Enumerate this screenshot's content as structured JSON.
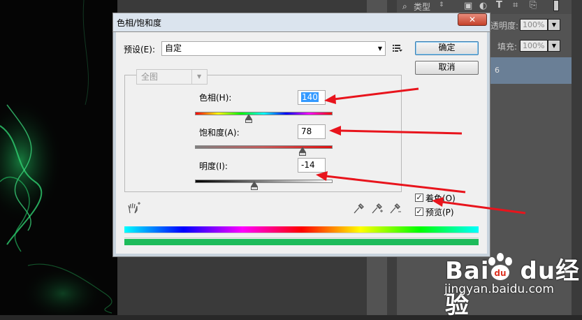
{
  "dialog": {
    "title": "色相/饱和度",
    "close_glyph": "✕",
    "preset_label": "预设(E):",
    "preset_value": "自定",
    "ok_label": "确定",
    "cancel_label": "取消",
    "channel_value": "全图",
    "hue_label": "色相(H):",
    "hue_value": "140",
    "hue_level": 140,
    "saturation_label": "饱和度(A):",
    "saturation_value": "78",
    "saturation_level": 78,
    "lightness_label": "明度(I):",
    "lightness_value": "-14",
    "lightness_level": -14,
    "colorize_label": "着色(O)",
    "colorize_checked": true,
    "preview_label": "预览(P)",
    "preview_checked": true
  },
  "right_panel": {
    "type_label": "类型",
    "opacity_label": "透明度:",
    "opacity_value": "100%",
    "fill_label": "填充:",
    "fill_value": "100%",
    "layer_text": "6"
  },
  "watermark": {
    "brand": "Baidu经验",
    "url": "jingyan.baidu.com"
  },
  "colors": {
    "arrow": "#e8141c",
    "colorize_result_bar": "#1dbb5a"
  }
}
